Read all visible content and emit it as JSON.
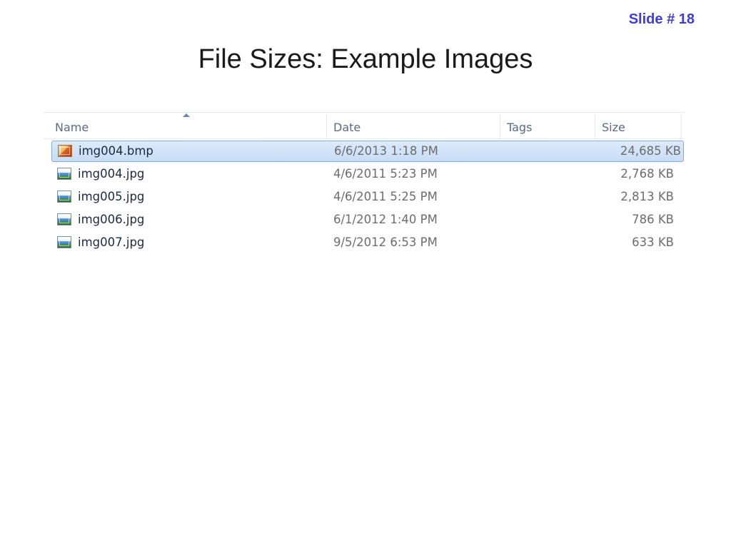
{
  "slide": {
    "number_label": "Slide # 18",
    "title": "File Sizes: Example Images"
  },
  "explorer": {
    "columns": {
      "name": "Name",
      "date": "Date",
      "tags": "Tags",
      "size": "Size"
    },
    "sort": {
      "column": "name",
      "icon": "sort-ascending-icon"
    },
    "files": [
      {
        "name": "img004.bmp",
        "date": "6/6/2013 1:18 PM",
        "tags": "",
        "size": "24,685 KB",
        "icon": "bitmap-image-file-icon",
        "selected": true
      },
      {
        "name": "img004.jpg",
        "date": "4/6/2011 5:23 PM",
        "tags": "",
        "size": "2,768 KB",
        "icon": "jpeg-image-file-icon",
        "selected": false
      },
      {
        "name": "img005.jpg",
        "date": "4/6/2011 5:25 PM",
        "tags": "",
        "size": "2,813 KB",
        "icon": "jpeg-image-file-icon",
        "selected": false
      },
      {
        "name": "img006.jpg",
        "date": "6/1/2012 1:40 PM",
        "tags": "",
        "size": "786 KB",
        "icon": "jpeg-image-file-icon",
        "selected": false
      },
      {
        "name": "img007.jpg",
        "date": "9/5/2012 6:53 PM",
        "tags": "",
        "size": "633 KB",
        "icon": "jpeg-image-file-icon",
        "selected": false
      }
    ]
  },
  "colors": {
    "slide_number": "#3c3ce0",
    "title": "#1a1a1a",
    "selection": "#c7dcf5",
    "header_text": "#5a6b85"
  }
}
